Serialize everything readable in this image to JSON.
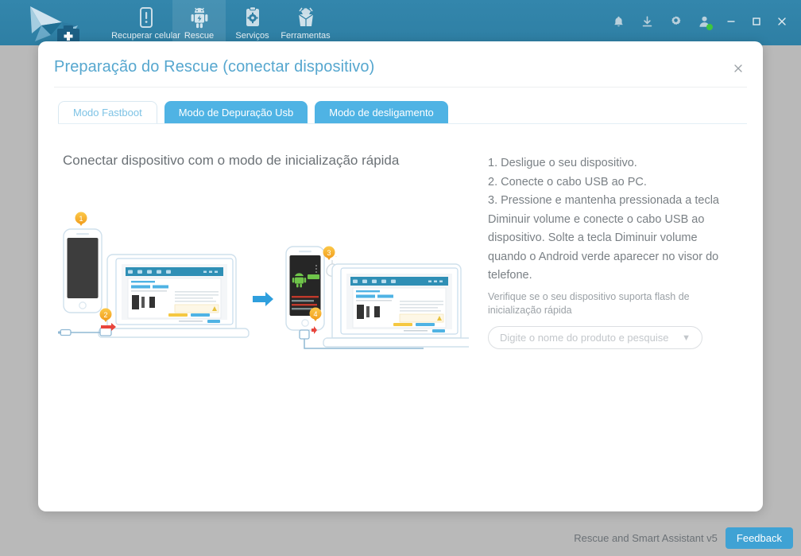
{
  "window": {
    "header_bg": "#2e7fa4",
    "logo_name": "rescue-bird-logo",
    "nav": [
      {
        "id": "device",
        "icon": "phone-alert-icon",
        "label": "Recuperar celular",
        "active": false
      },
      {
        "id": "rescue",
        "icon": "android-bolt-icon",
        "label": "Rescue",
        "active": true
      },
      {
        "id": "service",
        "icon": "clipboard-gear-icon",
        "label": "Serviços",
        "active": false
      },
      {
        "id": "firmware",
        "icon": "broken-box-icon",
        "label": "Ferramentas",
        "active": false
      }
    ],
    "actions": [
      {
        "id": "notifications",
        "icon": "bell-icon"
      },
      {
        "id": "downloads",
        "icon": "download-icon"
      },
      {
        "id": "settings",
        "icon": "gear-icon"
      },
      {
        "id": "account",
        "icon": "user-icon",
        "badge_color": "#3ec63e"
      }
    ],
    "controls": [
      {
        "id": "minimize",
        "icon": "minimize-icon"
      },
      {
        "id": "maximize",
        "icon": "maximize-icon"
      },
      {
        "id": "close",
        "icon": "close-icon"
      }
    ]
  },
  "dialog": {
    "title": "Preparação do Rescue (conectar dispositivo)",
    "close_icon": "close-icon",
    "title_color": "#56a7cf",
    "tabs": [
      {
        "label": "Modo Fastboot",
        "active": true
      },
      {
        "label": "Modo de Depuração Usb",
        "active": false
      },
      {
        "label": "Modo de desligamento",
        "active": false
      }
    ],
    "tab_active_color": "#ffffff",
    "tab_inactive_color": "#4fb3e4",
    "content": {
      "heading": "Conectar dispositivo com o modo de inicialização rápida",
      "steps": [
        "1. Desligue o seu dispositivo.",
        "2. Conecte o cabo USB ao PC.",
        "3. Pressione e mantenha pressionada a tecla Diminuir volume e conecte o cabo USB ao dispositivo. Solte a tecla Diminuir volume quando o Android verde aparecer no visor do telefone."
      ],
      "check_note": "Verifique se o seu dispositivo suporta flash de inicialização rápida",
      "product_select": {
        "placeholder": "Digite o nome do produto e pesquise",
        "value": "",
        "caret_icon": "chevron-down-icon"
      },
      "illustration": {
        "name": "fastboot-connection-diagram",
        "badges": [
          "1",
          "2",
          "3",
          "4"
        ],
        "arrow_icon": "arrow-right-icon",
        "android_color": "#6fc44a"
      }
    }
  },
  "footer": {
    "app_name": "Rescue and Smart Assistant v5",
    "feedback_label": "Feedback",
    "feedback_color": "#3fa2d4"
  }
}
